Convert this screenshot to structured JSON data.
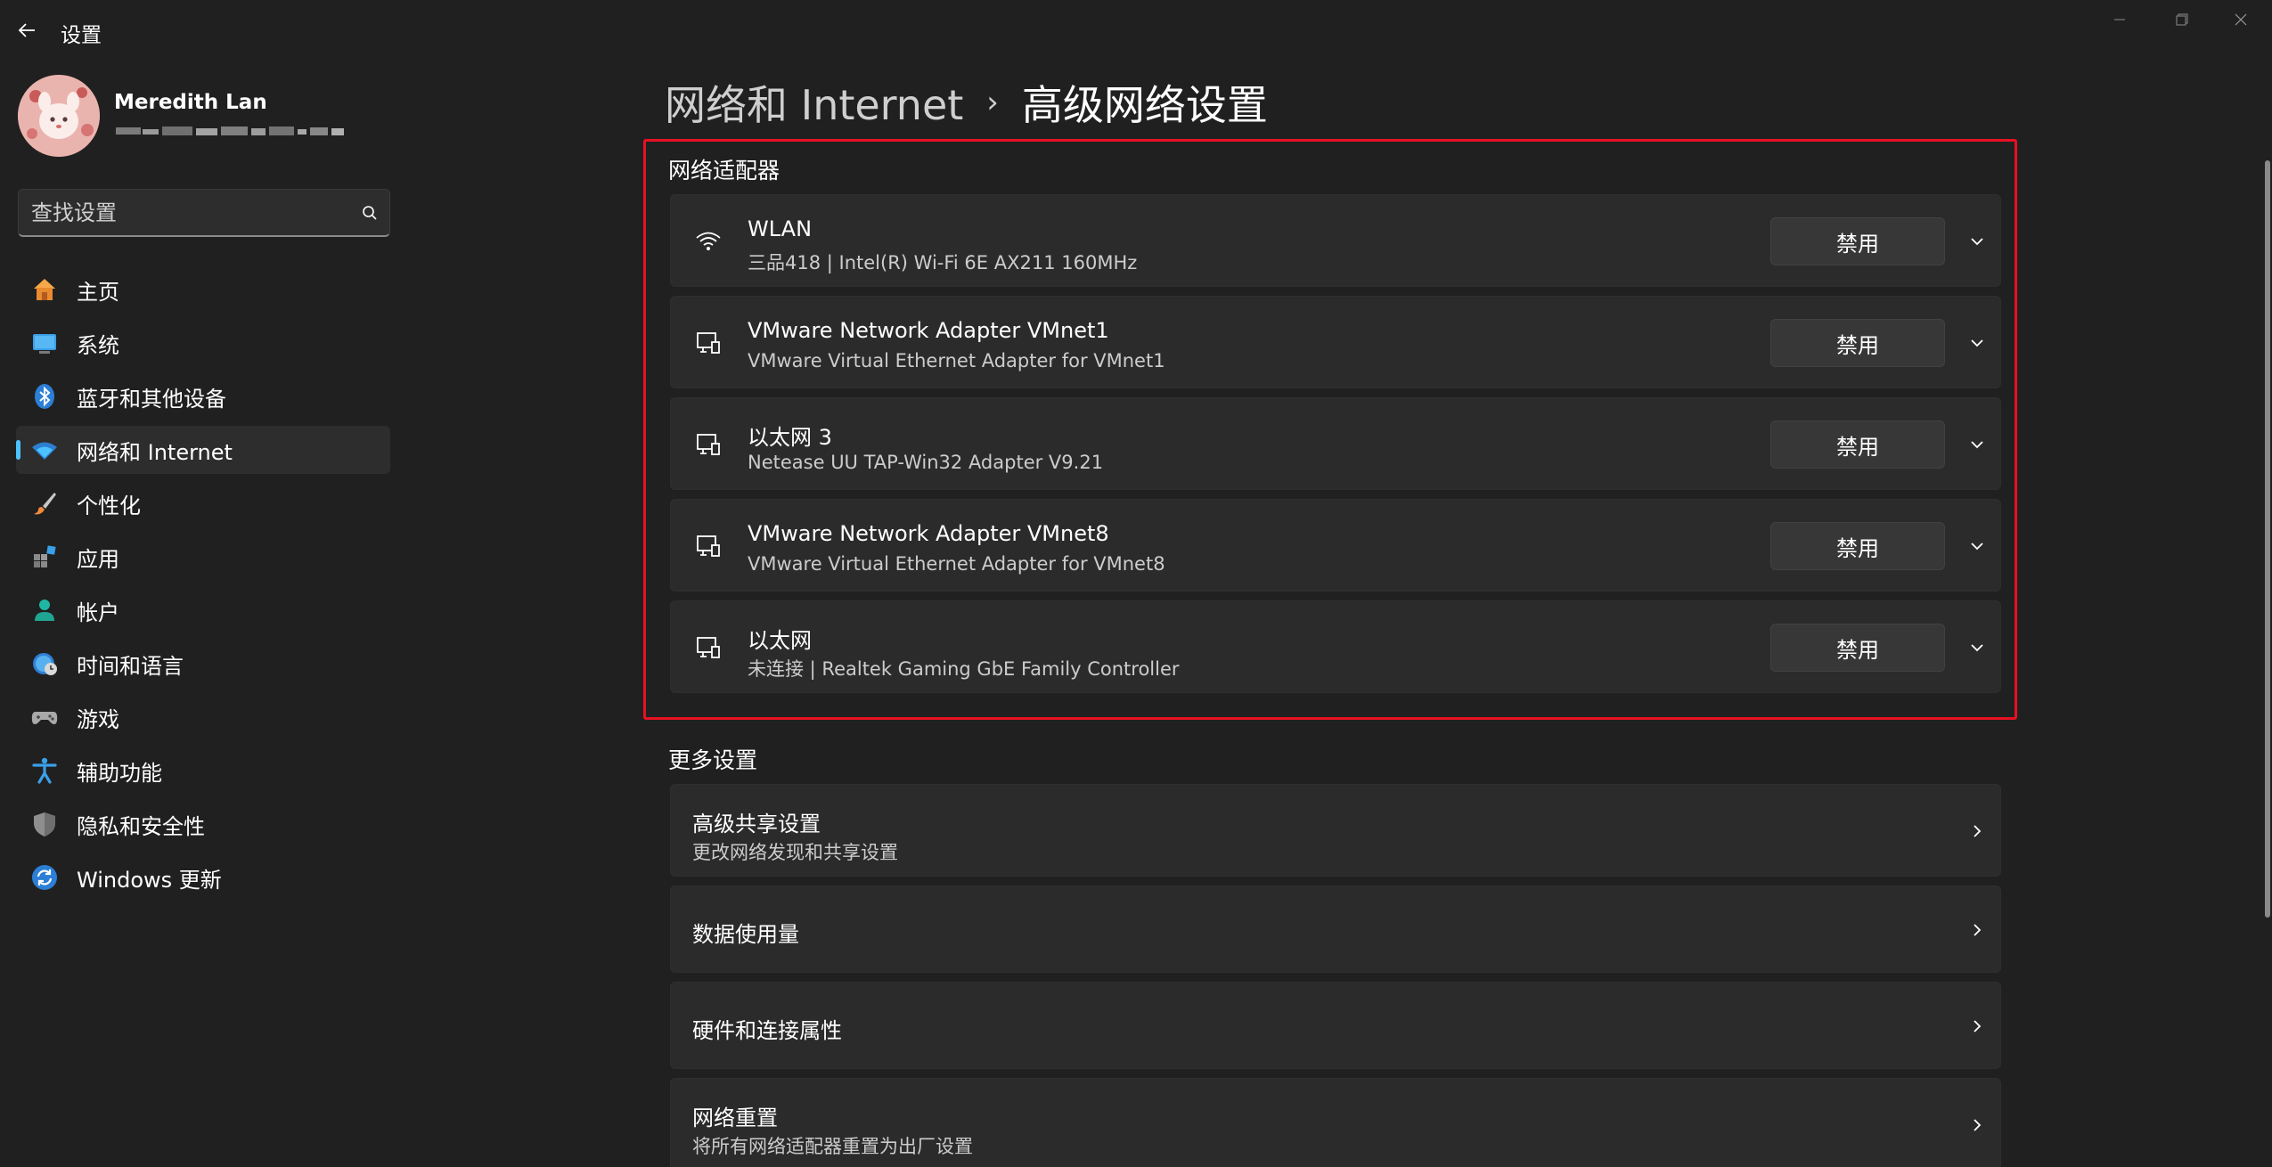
{
  "window": {
    "title": "设置",
    "controls": {
      "minimize": "minimize-icon",
      "maximize": "restore-icon",
      "close": "close-icon"
    }
  },
  "profile": {
    "name": "Meredith Lan",
    "email_redacted": true
  },
  "search": {
    "placeholder": "查找设置"
  },
  "nav": {
    "items": [
      {
        "label": "主页",
        "icon": "home-icon",
        "active": false
      },
      {
        "label": "系统",
        "icon": "system-icon",
        "active": false
      },
      {
        "label": "蓝牙和其他设备",
        "icon": "bluetooth-icon",
        "active": false
      },
      {
        "label": "网络和 Internet",
        "icon": "network-icon",
        "active": true
      },
      {
        "label": "个性化",
        "icon": "brush-icon",
        "active": false
      },
      {
        "label": "应用",
        "icon": "apps-icon",
        "active": false
      },
      {
        "label": "帐户",
        "icon": "account-icon",
        "active": false
      },
      {
        "label": "时间和语言",
        "icon": "time-language-icon",
        "active": false
      },
      {
        "label": "游戏",
        "icon": "gamepad-icon",
        "active": false
      },
      {
        "label": "辅助功能",
        "icon": "accessibility-icon",
        "active": false
      },
      {
        "label": "隐私和安全性",
        "icon": "shield-icon",
        "active": false
      },
      {
        "label": "Windows 更新",
        "icon": "update-icon",
        "active": false
      }
    ]
  },
  "breadcrumb": {
    "parent": "网络和 Internet",
    "separator": "›",
    "current": "高级网络设置"
  },
  "adapters": {
    "title": "网络适配器",
    "items": [
      {
        "name": "WLAN",
        "detail": "三品418 | Intel(R) Wi-Fi 6E AX211 160MHz",
        "icon": "wifi-icon",
        "button": "禁用"
      },
      {
        "name": "VMware Network Adapter VMnet1",
        "detail": "VMware Virtual Ethernet Adapter for VMnet1",
        "icon": "ethernet-icon",
        "button": "禁用"
      },
      {
        "name": "以太网 3",
        "detail": "Netease UU TAP-Win32 Adapter V9.21",
        "icon": "ethernet-icon",
        "button": "禁用"
      },
      {
        "name": "VMware Network Adapter VMnet8",
        "detail": "VMware Virtual Ethernet Adapter for VMnet8",
        "icon": "ethernet-icon",
        "button": "禁用"
      },
      {
        "name": "以太网",
        "detail": "未连接 | Realtek Gaming GbE Family Controller",
        "icon": "ethernet-icon",
        "button": "禁用"
      }
    ]
  },
  "more": {
    "title": "更多设置",
    "items": [
      {
        "title": "高级共享设置",
        "subtitle": "更改网络发现和共享设置"
      },
      {
        "title": "数据使用量",
        "subtitle": ""
      },
      {
        "title": "硬件和连接属性",
        "subtitle": ""
      },
      {
        "title": "网络重置",
        "subtitle": "将所有网络适配器重置为出厂设置"
      }
    ]
  },
  "colors": {
    "background": "#202020",
    "card": "#2b2b2b",
    "accent": "#4cc2ff",
    "highlight_border": "#e81123"
  }
}
